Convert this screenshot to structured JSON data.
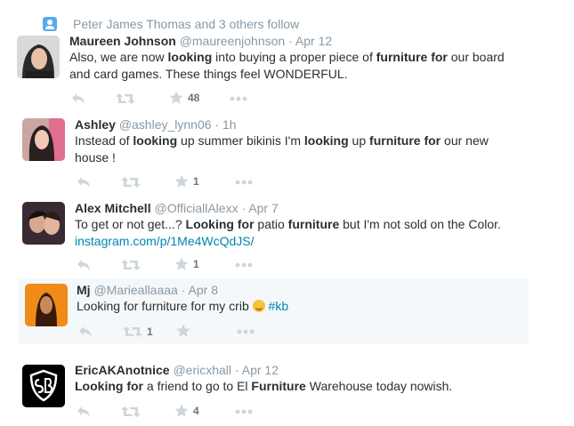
{
  "context": {
    "text": "Peter James Thomas and 3 others follow"
  },
  "tweets": [
    {
      "name": "Maureen Johnson",
      "handle": "@maureenjohnson",
      "time": "Apr 12",
      "line1": [
        [
          "t",
          "Also, we are now "
        ],
        [
          "b",
          "looking"
        ],
        [
          "t",
          " into buying a proper piece of "
        ],
        [
          "b",
          "furniture for"
        ],
        [
          "t",
          " our board"
        ]
      ],
      "line2": [
        [
          "t",
          "and card games. These things feel WONDERFUL."
        ]
      ],
      "retweets": "",
      "likes": "48"
    },
    {
      "name": "Ashley",
      "handle": "@ashley_lynn06",
      "time": "1h",
      "line1": [
        [
          "t",
          "Instead of "
        ],
        [
          "b",
          "looking"
        ],
        [
          "t",
          " up summer bikinis I'm "
        ],
        [
          "b",
          "looking"
        ],
        [
          "t",
          " up "
        ],
        [
          "b",
          "furniture for"
        ],
        [
          "t",
          " our new"
        ]
      ],
      "line2": [
        [
          "t",
          "house !"
        ]
      ],
      "retweets": "",
      "likes": "1"
    },
    {
      "name": "Alex Mitchell",
      "handle": "@OfficiallAlexx",
      "time": "Apr 7",
      "line1": [
        [
          "t",
          "To get or not get...? "
        ],
        [
          "b",
          "Looking for"
        ],
        [
          "t",
          " patio "
        ],
        [
          "b",
          "furniture"
        ],
        [
          "t",
          " but I'm not sold on the Color."
        ]
      ],
      "line2": [
        [
          "l",
          "instagram.com/p/1Me4WcQdJS/"
        ]
      ],
      "retweets": "",
      "likes": "1"
    },
    {
      "name": "Mj",
      "handle": "@Marieallaaaa",
      "time": "Apr 8",
      "line1": [
        [
          "t",
          "Looking for furniture for my crib "
        ],
        [
          "e",
          ""
        ],
        [
          "t",
          " "
        ],
        [
          "h",
          "#kb"
        ]
      ],
      "line2": [],
      "retweets": "1",
      "likes": ""
    },
    {
      "name": "EricAKAnotnice",
      "handle": "@ericxhall",
      "time": "Apr 12",
      "line1": [
        [
          "b",
          "Looking for"
        ],
        [
          "t",
          " a friend to go to El "
        ],
        [
          "b",
          "Furniture"
        ],
        [
          "t",
          " Warehouse today nowish."
        ]
      ],
      "line2": [],
      "retweets": "",
      "likes": "4"
    }
  ]
}
